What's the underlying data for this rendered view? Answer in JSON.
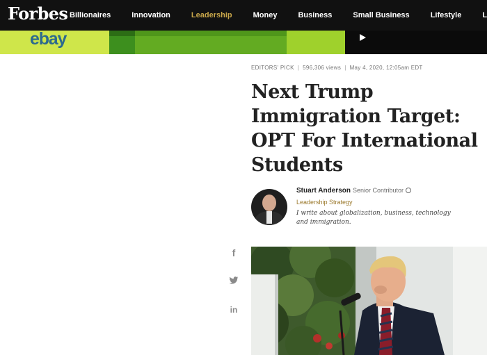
{
  "nav": {
    "logo": "Forbes",
    "items": [
      {
        "label": "Billionaires",
        "active": false
      },
      {
        "label": "Innovation",
        "active": false
      },
      {
        "label": "Leadership",
        "active": true
      },
      {
        "label": "Money",
        "active": false
      },
      {
        "label": "Business",
        "active": false
      },
      {
        "label": "Small Business",
        "active": false
      },
      {
        "label": "Lifestyle",
        "active": false
      },
      {
        "label": "L",
        "active": false
      }
    ],
    "active_color": "#c9a74a"
  },
  "ad": {
    "brand": "ebay",
    "play_icon": "play-icon"
  },
  "article": {
    "meta": {
      "label": "EDITORS' PICK",
      "views": "596,306 views",
      "date": "May 4, 2020, 12:05am EDT"
    },
    "headline_lines": [
      "Next Trump",
      "Immigration Target:",
      "OPT For International",
      "Students"
    ]
  },
  "author": {
    "name": "Stuart Anderson",
    "role": "Senior Contributor",
    "channel": "Leadership Strategy",
    "bio": "I write about globalization, business, technology and immigration."
  },
  "share": {
    "facebook_icon": "f",
    "twitter_icon": "twitter-icon",
    "linkedin_icon": "in"
  }
}
